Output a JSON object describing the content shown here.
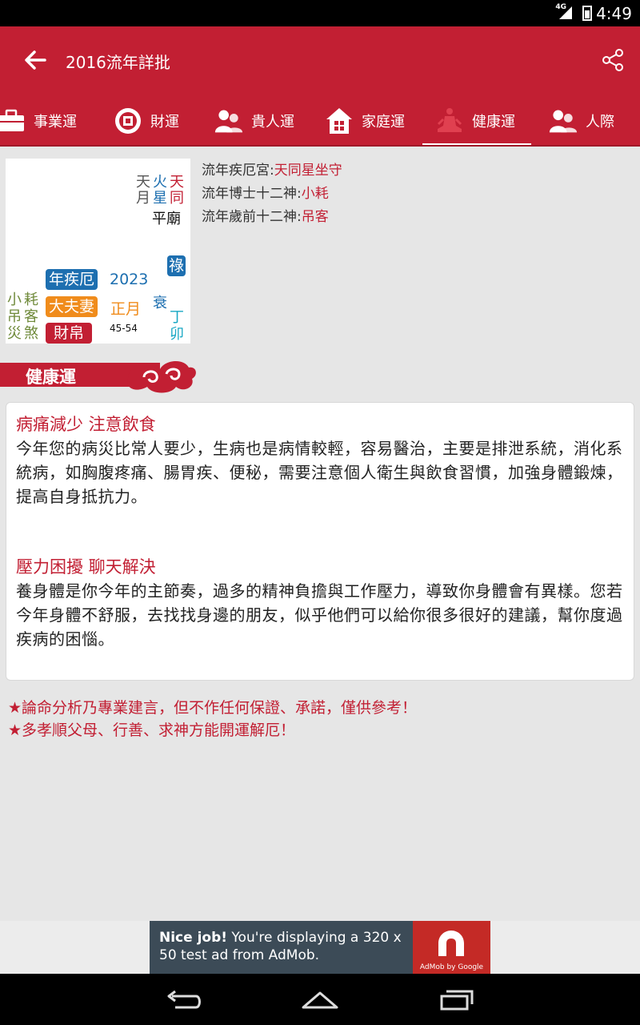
{
  "status": {
    "network": "4G",
    "time": "4:49"
  },
  "appbar": {
    "title": "2016流年詳批"
  },
  "tabs": [
    {
      "label": "事業運",
      "icon": "briefcase-icon"
    },
    {
      "label": "財運",
      "icon": "coin-icon"
    },
    {
      "label": "貴人運",
      "icon": "people-icon"
    },
    {
      "label": "家庭運",
      "icon": "house-icon"
    },
    {
      "label": "健康運",
      "icon": "meditation-icon"
    },
    {
      "label": "人際",
      "icon": "persons-icon"
    }
  ],
  "active_tab": "健康運",
  "palace": {
    "stars_top": {
      "c1": "天月",
      "c2": "火星",
      "c3": "天同",
      "c4": "平廟"
    },
    "lu": "祿",
    "palace_badge": "年疾厄",
    "year": "2023",
    "shuai": "衰",
    "spouse_badge": "大夫妻",
    "month": "正月",
    "wealth_badge": "財帛",
    "age_range": "45-54",
    "ganzhi": "丁卯",
    "minor_stars": {
      "c1": "小吊災",
      "c2": "耗客煞"
    }
  },
  "info": {
    "line1_label": "流年疾厄宮:",
    "line1_value": "天同星坐守",
    "line2_label": "流年博士十二神:",
    "line2_value": "小耗",
    "line3_label": "流年歲前十二神:",
    "line3_value": "吊客"
  },
  "section_title": "健康運",
  "content": {
    "h1": "病痛減少  注意飲食",
    "p1": "今年您的病災比常人要少，生病也是病情較輕，容易醫治，主要是排泄系統，消化系統病，如胸腹疼痛、腸胃疾、便秘，需要注意個人衛生與飲食習慣，加強身體鍛煉，提高自身抵抗力。",
    "h2": "壓力困擾  聊天解決",
    "p2": "養身體是你今年的主節奏，過多的精神負擔與工作壓力，導致你身體會有異樣。您若今年身體不舒服，去找找身邊的朋友，似乎他們可以給你很多很好的建議，幫你度過疾病的困惱。"
  },
  "notes": [
    "★論命分析乃專業建言，但不作任何保證、承諾，僅供參考！",
    "★多孝順父母、行善、求神方能開運解厄！"
  ],
  "ad": {
    "bold": "Nice job!",
    "text": " You're displaying a 320 x 50 test ad from AdMob.",
    "brand": "AdMob by Google"
  },
  "colors": {
    "primary": "#c21f33",
    "blue": "#1d6fb0",
    "orange": "#f08c1c",
    "cyan": "#1aa8c4",
    "olive": "#6f8a3a"
  }
}
